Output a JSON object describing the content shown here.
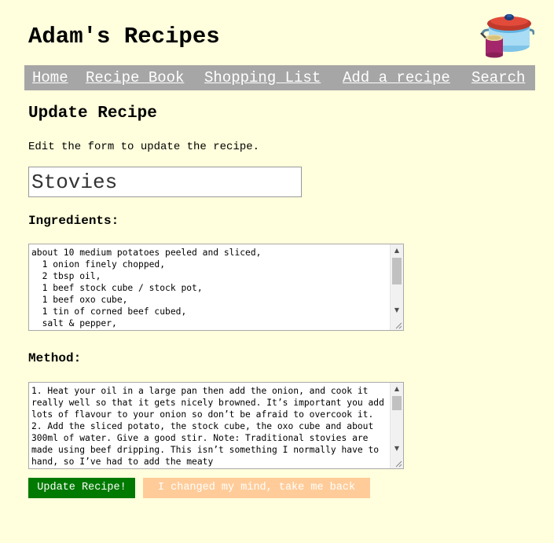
{
  "site": {
    "title": "Adam's Recipes",
    "logo_icon": "cooking-pot-icon"
  },
  "nav": {
    "items": [
      {
        "label": "Home"
      },
      {
        "label": "Recipe Book"
      },
      {
        "label": "Shopping List"
      },
      {
        "label": "Add a recipe"
      },
      {
        "label": "Search"
      }
    ]
  },
  "page": {
    "heading": "Update Recipe",
    "intro": "Edit the form to update the recipe."
  },
  "form": {
    "title_value": "Stovies",
    "ingredients_label": "Ingredients:",
    "ingredients_value": "about 10 medium potatoes peeled and sliced,\n  1 onion finely chopped,\n  2 tbsp oil,\n  1 beef stock cube / stock pot,\n  1 beef oxo cube,\n  1 tin of corned beef cubed,\n  salt & pepper,",
    "method_label": "Method:",
    "method_value": "1. Heat your oil in a large pan then add the onion, and cook it really well so that it gets nicely browned. It’s important you add lots of flavour to your onion so don’t be afraid to overcook it. 2. Add the sliced potato, the stock cube, the oxo cube and about 300ml of water. Give a good stir. Note: Traditional stovies are made using beef dripping. This isn’t something I normally have to hand, so I’ve had to add the meaty",
    "update_button": "Update Recipe!",
    "cancel_button": "I changed my mind, take me back"
  },
  "colors": {
    "page_background": "#ffffdd",
    "nav_background": "#a6a6a6",
    "update_button": "#007a00",
    "cancel_button": "#ffcc99"
  }
}
